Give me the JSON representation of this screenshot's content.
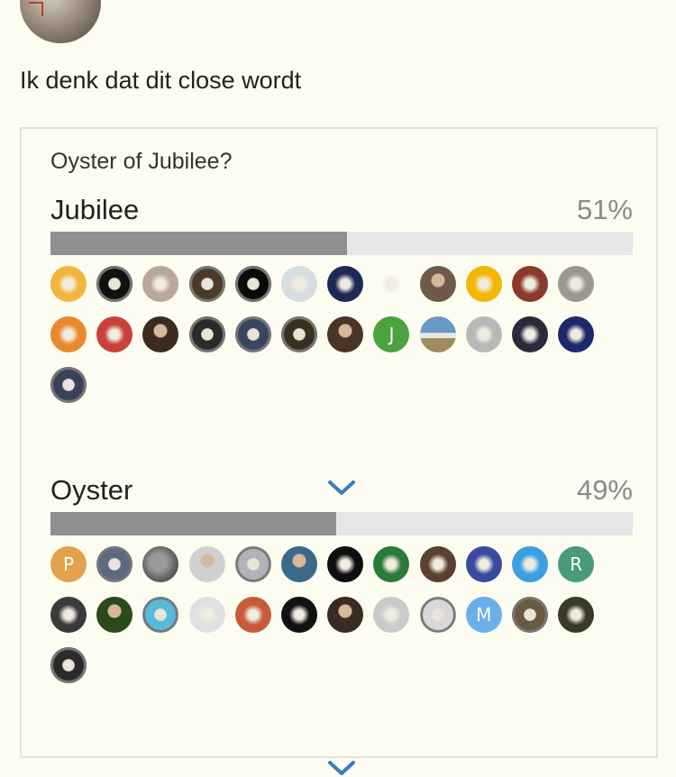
{
  "post": {
    "text": "Ik denk dat dit close wordt"
  },
  "poll": {
    "question": "Oyster of Jubilee?",
    "expand_icon": "chevron-down-icon",
    "accent_color": "#3a7cc2",
    "options": [
      {
        "label": "Jubilee",
        "percent_text": "51%",
        "percent": 51,
        "voters": [
          {
            "letter": "",
            "color": "#f2b63c",
            "kind": "text-logo"
          },
          {
            "letter": "",
            "color": "#111111",
            "kind": "watch"
          },
          {
            "letter": "",
            "color": "#b9a89a",
            "kind": "cat"
          },
          {
            "letter": "",
            "color": "#4a3a2a",
            "kind": "watch"
          },
          {
            "letter": "",
            "color": "#0a0a0a",
            "kind": "watch"
          },
          {
            "letter": "",
            "color": "#d8dde2",
            "kind": "sketch"
          },
          {
            "letter": "",
            "color": "#1d2a55",
            "kind": "cartoon"
          },
          {
            "letter": "",
            "color": "#fdfcf1",
            "kind": "figure"
          },
          {
            "letter": "",
            "color": "#6f5a4a",
            "kind": "portrait"
          },
          {
            "letter": "",
            "color": "#f2b800",
            "kind": "logo"
          },
          {
            "letter": "",
            "color": "#8a3a2a",
            "kind": "pattern"
          },
          {
            "letter": "",
            "color": "#9c9890",
            "kind": "photo"
          },
          {
            "letter": "",
            "color": "#e8892c",
            "kind": "logo"
          },
          {
            "letter": "",
            "color": "#c8413a",
            "kind": "pattern"
          },
          {
            "letter": "",
            "color": "#3a2a20",
            "kind": "portrait"
          },
          {
            "letter": "",
            "color": "#2a2a2a",
            "kind": "watch"
          },
          {
            "letter": "",
            "color": "#3a4560",
            "kind": "watch"
          },
          {
            "letter": "",
            "color": "#3a3020",
            "kind": "watch"
          },
          {
            "letter": "",
            "color": "#4a3428",
            "kind": "portrait"
          },
          {
            "letter": "J",
            "color": "#4aa33d",
            "kind": "letter"
          },
          {
            "letter": "",
            "color": "#6a90b8",
            "kind": "landscape"
          },
          {
            "letter": "",
            "color": "#b8b8b8",
            "kind": "photo"
          },
          {
            "letter": "",
            "color": "#2a2a3a",
            "kind": "photo"
          },
          {
            "letter": "",
            "color": "#1d2a6a",
            "kind": "symbol"
          },
          {
            "letter": "",
            "color": "#3a4258",
            "kind": "watch"
          }
        ]
      },
      {
        "label": "Oyster",
        "percent_text": "49%",
        "percent": 49,
        "voters": [
          {
            "letter": "P",
            "color": "#e2a14a",
            "kind": "letter"
          },
          {
            "letter": "",
            "color": "#5a6a80",
            "kind": "watch"
          },
          {
            "letter": "",
            "color": "#5a5a5a",
            "kind": "moon"
          },
          {
            "letter": "",
            "color": "#d0d0d0",
            "kind": "portrait"
          },
          {
            "letter": "",
            "color": "#b0b4b8",
            "kind": "watch"
          },
          {
            "letter": "",
            "color": "#3a6a8a",
            "kind": "portrait"
          },
          {
            "letter": "",
            "color": "#0f0f0f",
            "kind": "mask"
          },
          {
            "letter": "",
            "color": "#2a7a3a",
            "kind": "cartoon"
          },
          {
            "letter": "",
            "color": "#5a4030",
            "kind": "owl"
          },
          {
            "letter": "",
            "color": "#3a4aa0",
            "kind": "cartoon"
          },
          {
            "letter": "",
            "color": "#3aa0e0",
            "kind": "cartoon"
          },
          {
            "letter": "R",
            "color": "#4a9a7a",
            "kind": "letter"
          },
          {
            "letter": "",
            "color": "#3a3a3a",
            "kind": "snowflake"
          },
          {
            "letter": "",
            "color": "#2a4a1a",
            "kind": "portrait"
          },
          {
            "letter": "",
            "color": "#5ab8d8",
            "kind": "watch"
          },
          {
            "letter": "",
            "color": "#e0e0e0",
            "kind": "photo"
          },
          {
            "letter": "",
            "color": "#c85a3a",
            "kind": "cartoon"
          },
          {
            "letter": "",
            "color": "#111111",
            "kind": "logo"
          },
          {
            "letter": "",
            "color": "#3a2a22",
            "kind": "portrait"
          },
          {
            "letter": "",
            "color": "#c8ccc8",
            "kind": "photo"
          },
          {
            "letter": "",
            "color": "#d8d8d8",
            "kind": "watch"
          },
          {
            "letter": "M",
            "color": "#6ab0e8",
            "kind": "letter"
          },
          {
            "letter": "",
            "color": "#6a5a40",
            "kind": "watch"
          },
          {
            "letter": "",
            "color": "#3a3a2a",
            "kind": "logo"
          },
          {
            "letter": "",
            "color": "#2a2a2a",
            "kind": "watch"
          }
        ]
      }
    ]
  }
}
